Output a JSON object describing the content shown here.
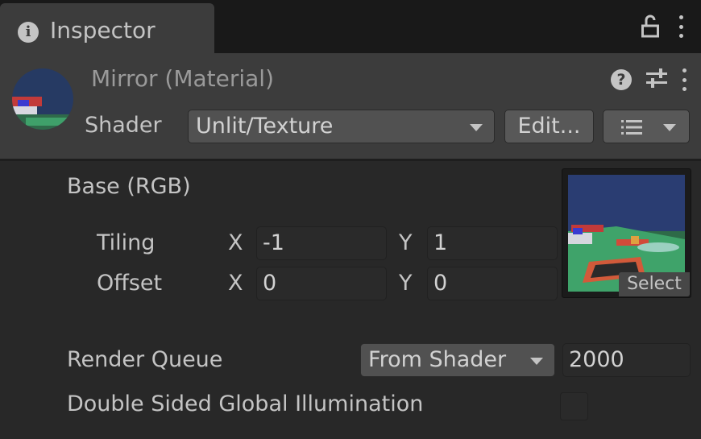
{
  "tab": {
    "title": "Inspector",
    "info_icon": "info-icon",
    "lock_icon": "lock-icon",
    "menu_icon": "kebab-menu-icon"
  },
  "header": {
    "title": "Mirror (Material)",
    "help_icon": "help-icon",
    "settings_icon": "sliders-icon",
    "menu_icon": "kebab-menu-icon",
    "shader_label": "Shader",
    "shader_value": "Unlit/Texture",
    "edit_label": "Edit...",
    "list_icon": "list-icon"
  },
  "properties": {
    "base_label": "Base (RGB)",
    "tiling_label": "Tiling",
    "offset_label": "Offset",
    "x_label": "X",
    "y_label": "Y",
    "tiling_x": "-1",
    "tiling_y": "1",
    "offset_x": "0",
    "offset_y": "0",
    "select_label": "Select",
    "render_queue_label": "Render Queue",
    "render_queue_mode": "From Shader",
    "render_queue_value": "2000",
    "double_sided_gi_label": "Double Sided Global Illumination",
    "double_sided_gi_checked": false
  },
  "colors": {
    "window_bg": "#282828",
    "header_bg": "#3c3c3c",
    "tabbar_bg": "#191919",
    "field_bg": "#2a2a2a",
    "button_bg": "#585858",
    "text": "#c4c4c4"
  }
}
